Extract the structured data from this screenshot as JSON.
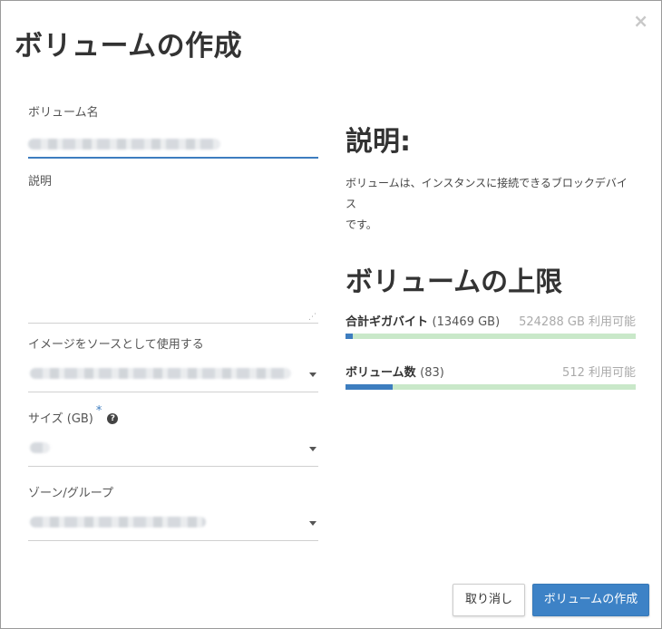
{
  "modal": {
    "title": "ボリュームの作成",
    "close_icon": "×"
  },
  "form": {
    "name_label": "ボリューム名",
    "description_label": "説明",
    "image_source_label": "イメージをソースとして使用する",
    "size_label": "サイズ (GB)",
    "size_required_mark": "*",
    "size_help_icon": "?",
    "zone_label": "ゾーン/グループ",
    "resize_grip": "⋰"
  },
  "info": {
    "description_heading": "説明:",
    "description_text_line1": "ボリュームは、インスタンスに接続できるブロックデバイス",
    "description_text_line2": "です。",
    "limits_heading": "ボリュームの上限",
    "quotas": [
      {
        "label": "合計ギガバイト",
        "used_display": "(13469 GB)",
        "available": "524288 GB 利用可能",
        "used_fraction": 0.026
      },
      {
        "label": "ボリューム数",
        "used_display": "(83)",
        "available": "512 利用可能",
        "used_fraction": 0.162
      }
    ]
  },
  "footer": {
    "cancel_label": "取り消し",
    "create_label": "ボリュームの作成"
  },
  "colors": {
    "accent": "#3d82c6",
    "bar_track": "#c9e8c9",
    "bar_fill": "#3d7dbf"
  }
}
